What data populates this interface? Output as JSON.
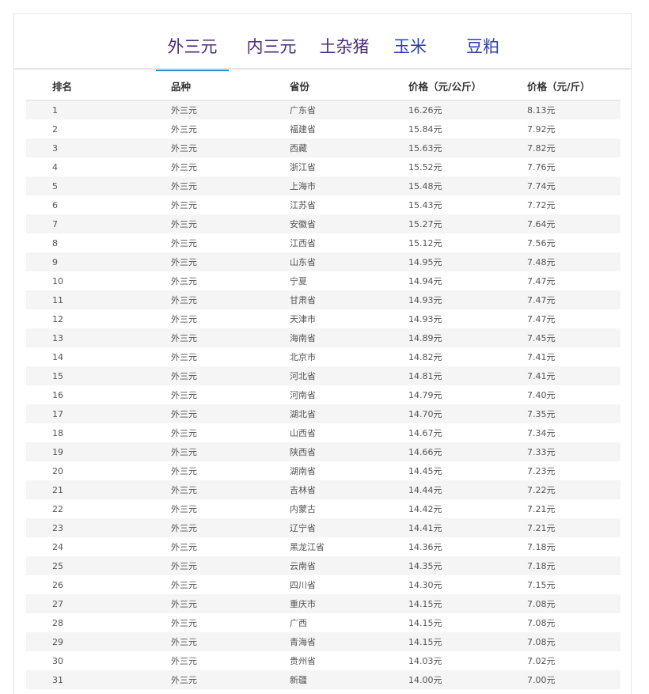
{
  "tabs": [
    {
      "label": "外三元",
      "active": true
    },
    {
      "label": "内三元",
      "active": false
    },
    {
      "label": "土杂猪",
      "active": false
    },
    {
      "label": "玉米",
      "active": false
    },
    {
      "label": "豆粕",
      "active": false
    }
  ],
  "colors": {
    "tab_text": "#4a2b78",
    "tab_text_blue": "#2b3fb0",
    "active_underline": "#2b8fd6",
    "row_stripe": "#f5f5f5",
    "border": "#e6e6e6"
  },
  "table": {
    "headers": [
      "排名",
      "品种",
      "省份",
      "价格（元/公斤）",
      "价格（元/斤）"
    ],
    "rows": [
      [
        "1",
        "外三元",
        "广东省",
        "16.26元",
        "8.13元"
      ],
      [
        "2",
        "外三元",
        "福建省",
        "15.84元",
        "7.92元"
      ],
      [
        "3",
        "外三元",
        "西藏",
        "15.63元",
        "7.82元"
      ],
      [
        "4",
        "外三元",
        "浙江省",
        "15.52元",
        "7.76元"
      ],
      [
        "5",
        "外三元",
        "上海市",
        "15.48元",
        "7.74元"
      ],
      [
        "6",
        "外三元",
        "江苏省",
        "15.43元",
        "7.72元"
      ],
      [
        "7",
        "外三元",
        "安徽省",
        "15.27元",
        "7.64元"
      ],
      [
        "8",
        "外三元",
        "江西省",
        "15.12元",
        "7.56元"
      ],
      [
        "9",
        "外三元",
        "山东省",
        "14.95元",
        "7.48元"
      ],
      [
        "10",
        "外三元",
        "宁夏",
        "14.94元",
        "7.47元"
      ],
      [
        "11",
        "外三元",
        "甘肃省",
        "14.93元",
        "7.47元"
      ],
      [
        "12",
        "外三元",
        "天津市",
        "14.93元",
        "7.47元"
      ],
      [
        "13",
        "外三元",
        "海南省",
        "14.89元",
        "7.45元"
      ],
      [
        "14",
        "外三元",
        "北京市",
        "14.82元",
        "7.41元"
      ],
      [
        "15",
        "外三元",
        "河北省",
        "14.81元",
        "7.41元"
      ],
      [
        "16",
        "外三元",
        "河南省",
        "14.79元",
        "7.40元"
      ],
      [
        "17",
        "外三元",
        "湖北省",
        "14.70元",
        "7.35元"
      ],
      [
        "18",
        "外三元",
        "山西省",
        "14.67元",
        "7.34元"
      ],
      [
        "19",
        "外三元",
        "陕西省",
        "14.66元",
        "7.33元"
      ],
      [
        "20",
        "外三元",
        "湖南省",
        "14.45元",
        "7.23元"
      ],
      [
        "21",
        "外三元",
        "吉林省",
        "14.44元",
        "7.22元"
      ],
      [
        "22",
        "外三元",
        "内蒙古",
        "14.42元",
        "7.21元"
      ],
      [
        "23",
        "外三元",
        "辽宁省",
        "14.41元",
        "7.21元"
      ],
      [
        "24",
        "外三元",
        "黑龙江省",
        "14.36元",
        "7.18元"
      ],
      [
        "25",
        "外三元",
        "云南省",
        "14.35元",
        "7.18元"
      ],
      [
        "26",
        "外三元",
        "四川省",
        "14.30元",
        "7.15元"
      ],
      [
        "27",
        "外三元",
        "重庆市",
        "14.15元",
        "7.08元"
      ],
      [
        "28",
        "外三元",
        "广西",
        "14.15元",
        "7.08元"
      ],
      [
        "29",
        "外三元",
        "青海省",
        "14.15元",
        "7.08元"
      ],
      [
        "30",
        "外三元",
        "贵州省",
        "14.03元",
        "7.02元"
      ],
      [
        "31",
        "外三元",
        "新疆",
        "14.00元",
        "7.00元"
      ]
    ]
  }
}
